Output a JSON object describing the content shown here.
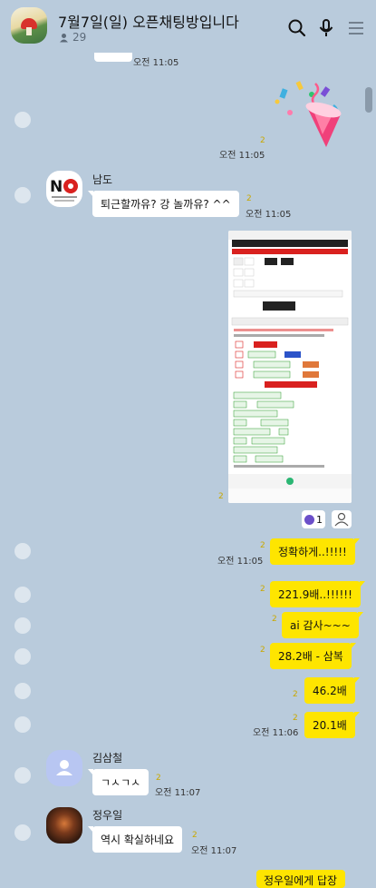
{
  "header": {
    "title": "7월7일(일) 오픈채팅방입니다",
    "members": "29"
  },
  "messages": {
    "top_time": "오전 11:05",
    "party_time": "오전 11:05",
    "party_unread": "2",
    "namdo_name": "남도",
    "namdo_text": "퇴근할까유? 강 놀까유? ^^",
    "namdo_unread": "2",
    "namdo_time": "오전 11:05",
    "shot_unread": "2",
    "reaction_count": "1",
    "m1_text": "정확하게..!!!!!",
    "m1_unread": "2",
    "m1_time": "오전 11:05",
    "m2_text": "221.9배..!!!!!!",
    "m2_unread": "2",
    "m3_text": "ai 감사~~~",
    "m3_unread": "2",
    "m4_text": "28.2배 - 삼복",
    "m4_unread": "2",
    "m5_text": "46.2배",
    "m5_unread": "2",
    "m6_text": "20.1배",
    "m6_unread": "2",
    "m6_time": "오전 11:06",
    "kim_name": "김삼철",
    "kim_text": "ㄱㅅㄱㅅ",
    "kim_unread": "2",
    "kim_time": "오전 11:07",
    "jung_name": "정우일",
    "jung_text": "역시 확실하네요",
    "jung_unread": "2",
    "jung_time": "오전 11:07",
    "reply_text": "정우일에게 답장"
  },
  "colors": {
    "bg": "#b9cbdc",
    "mine": "#fee500",
    "theirs": "#ffffff"
  },
  "icons": [
    "search-icon",
    "microphone-icon",
    "menu-icon",
    "person-icon"
  ]
}
